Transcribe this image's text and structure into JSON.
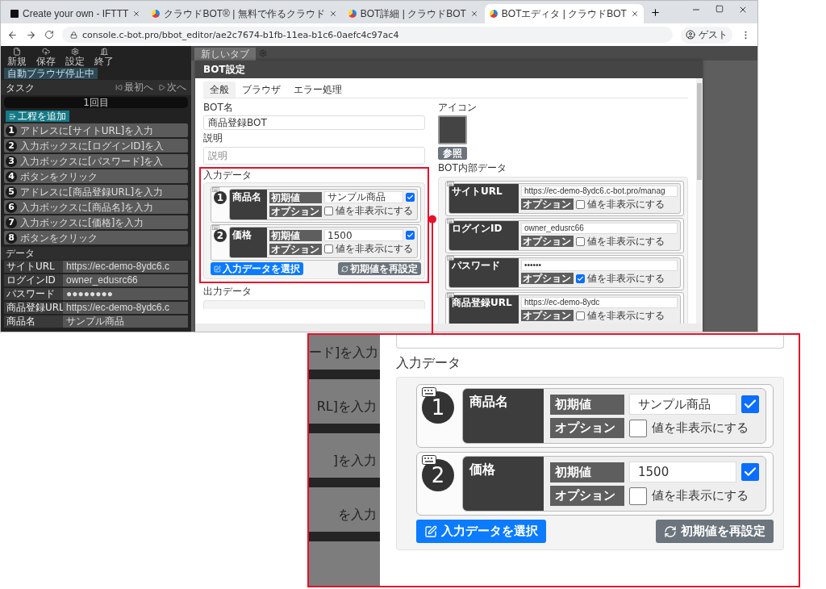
{
  "browser": {
    "tabs": [
      {
        "title": "Create your own - IFTTT",
        "kind": "ifttt",
        "selected": false
      },
      {
        "title": "クラウドBOT® | 無料で作るクラウド",
        "kind": "cbot",
        "selected": false
      },
      {
        "title": "BOT詳細 | クラウドBOT",
        "kind": "cbot",
        "selected": false
      },
      {
        "title": "BOTエディタ | クラウドBOT",
        "kind": "cbot",
        "selected": true
      }
    ],
    "address": "console.c-bot.pro/bbot_editor/ae2c7674-b1fb-11ea-b1c6-0aefc4c97ac4",
    "profile": "ゲスト"
  },
  "app": {
    "toolbar": [
      {
        "label": "新規",
        "kind": "new"
      },
      {
        "label": "保存",
        "kind": "save"
      },
      {
        "label": "設定",
        "kind": "settings"
      },
      {
        "label": "終了",
        "kind": "exit"
      }
    ],
    "status_badge": "自動ブラウザ停止中",
    "tasks_title": "タスク",
    "nav": [
      {
        "label": "最初へ",
        "kind": "first"
      },
      {
        "label": "次へ",
        "kind": "next"
      }
    ],
    "run_label": "1回目",
    "add_step": "工程を追加",
    "tasks": [
      {
        "number": "1",
        "label": "アドレスに[サイトURL]を入力"
      },
      {
        "number": "2",
        "label": "入力ボックスに[ログインID]を入"
      },
      {
        "number": "3",
        "label": "入力ボックスに[パスワード]を入"
      },
      {
        "number": "4",
        "label": "ボタンをクリック"
      },
      {
        "number": "5",
        "label": "アドレスに[商品登録URL]を入力"
      },
      {
        "number": "6",
        "label": "入力ボックスに[商品名]を入力"
      },
      {
        "number": "7",
        "label": "入力ボックスに[価格]を入力"
      },
      {
        "number": "8",
        "label": "ボタンをクリック"
      }
    ],
    "data_title": "データ",
    "data": [
      {
        "name": "サイトURL",
        "value": "https://ec-demo-8ydc6.c"
      },
      {
        "name": "ログインID",
        "value": "owner_edusrc66"
      },
      {
        "name": "パスワード",
        "value": "●●●●●●●●"
      },
      {
        "name": "商品登録URL",
        "value": "https://ec-demo-8ydc6.c"
      },
      {
        "name": "商品名",
        "value": "サンプル商品"
      }
    ],
    "editor_tab": "新しいタブ"
  },
  "modal": {
    "title": "BOT設定",
    "tabs": [
      {
        "label": "全般",
        "selected": true
      },
      {
        "label": "ブラウザ",
        "selected": false
      },
      {
        "label": "エラー処理",
        "selected": false
      }
    ],
    "bot_name_label": "BOT名",
    "bot_name": "商品登録BOT",
    "description_label": "説明",
    "description_placeholder": "説明",
    "input_data_label": "入力データ",
    "input_data": [
      {
        "number": "1",
        "name": "商品名",
        "initial_label": "初期値",
        "value": "サンプル商品",
        "checked": true,
        "option_label": "オプション",
        "hide_label": "値を非表示にする",
        "hidden": false
      },
      {
        "number": "2",
        "name": "価格",
        "initial_label": "初期値",
        "value": "1500",
        "checked": true,
        "option_label": "オプション",
        "hide_label": "値を非表示にする",
        "hidden": false
      }
    ],
    "select_button": "入力データを選択",
    "reset_button": "初期値を再設定",
    "output_data_label": "出力データ",
    "icon_label": "アイコン",
    "browse_button": "参照",
    "internal_data_label": "BOT内部データ",
    "internal_data": [
      {
        "name": "サイトURL",
        "value": "https://ec-demo-8ydc6.c-bot.pro/manag",
        "option_label": "オプション",
        "hide_label": "値を非表示にする",
        "hidden": false
      },
      {
        "name": "ログインID",
        "value": "owner_edusrc66",
        "option_label": "オプション",
        "hide_label": "値を非表示にする",
        "hidden": false
      },
      {
        "name": "パスワード",
        "value": "••••••",
        "option_label": "オプション",
        "hide_label": "値を非表示にする",
        "hidden": true
      },
      {
        "name": "商品登録URL",
        "value": "https://ec-demo-8ydc",
        "option_label": "オプション",
        "hide_label": "値を非表示にする",
        "hidden": false
      }
    ]
  },
  "callout": {
    "side_fragments": [
      "ード]を入力",
      "RL]を入力",
      "]を入力",
      "を入力"
    ],
    "input_data_label": "入力データ",
    "input_data": [
      {
        "number": "1",
        "name": "商品名",
        "initial_label": "初期値",
        "value": "サンプル商品",
        "checked": true,
        "option_label": "オプション",
        "hide_label": "値を非表示にする",
        "hidden": false
      },
      {
        "number": "2",
        "name": "価格",
        "initial_label": "初期値",
        "value": "1500",
        "checked": true,
        "option_label": "オプション",
        "hide_label": "値を非表示にする",
        "hidden": false
      }
    ],
    "select_button": "入力データを選択",
    "reset_button": "初期値を再設定"
  }
}
